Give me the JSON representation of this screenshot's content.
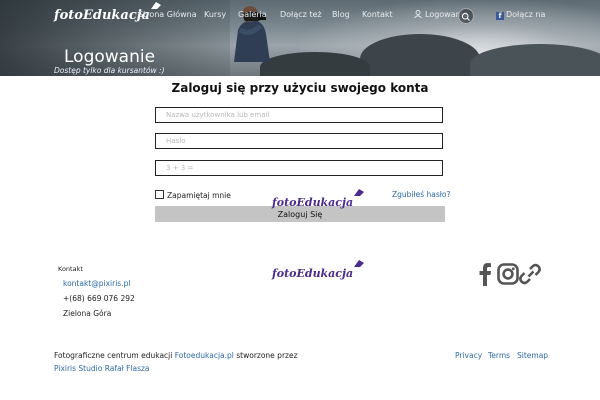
{
  "header": {
    "logo_text": "fotoEdukacja",
    "nav": [
      "Strona Główna",
      "Kursy",
      "Galeria",
      "Dołącz też",
      "Blog",
      "Kontakt"
    ],
    "login_label": "Logowanie",
    "facebook_label": "Dołącz na"
  },
  "hero": {
    "title": "Logowanie",
    "subtitle": "Dostęp tylko dla kursantów :)"
  },
  "login_form": {
    "heading": "Zaloguj się przy użyciu swojego konta",
    "username_placeholder": "Nazwa użytkownika lub email",
    "password_placeholder": "Hasło",
    "captcha_placeholder": "3 + 3 =",
    "remember_label": "Zapamiętaj mnie",
    "forgot_label": "Zgubiłeś hasło?",
    "submit_label": "Zaloguj Się",
    "logo_text": "fotoEdukacja"
  },
  "footer": {
    "contact_heading": "Kontakt",
    "email": "kontakt@pixiris.pl",
    "phone": "+(68) 669 076 292",
    "city": "Zielona Góra",
    "logo_text": "fotoEdukacja",
    "credits_prefix": "Fotograficzne centrum edukacji",
    "credits_site": "Fotoedukacja.pl",
    "credits_suffix": "stworzone przez",
    "credits_studio": "Pixiris Studio Rafał Flasza",
    "links": [
      "Privacy",
      "Terms",
      "Sitemap"
    ],
    "social_icons": [
      "facebook-icon",
      "instagram-icon",
      "link-icon"
    ]
  },
  "colors": {
    "link": "#2d6aa8",
    "logo_purple": "#4a2a8c",
    "button_bg": "#c4c4c4",
    "facebook": "#3b5998"
  }
}
